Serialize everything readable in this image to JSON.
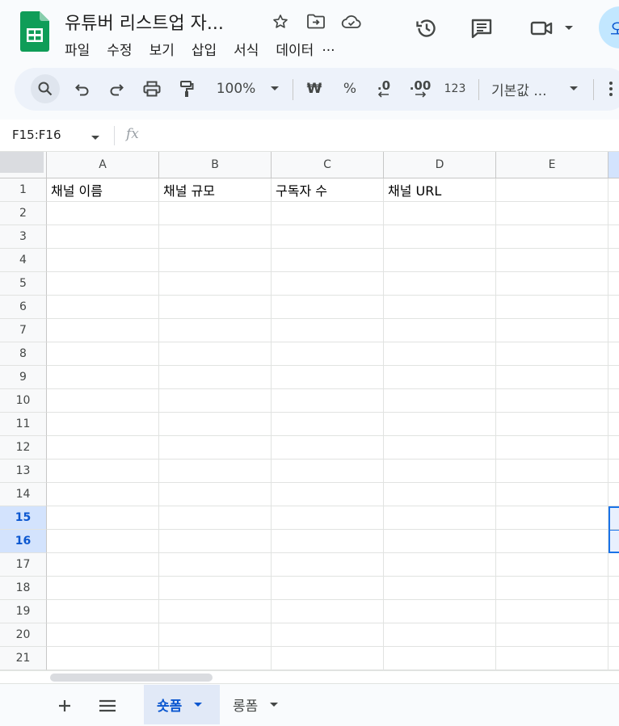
{
  "app": {
    "title": "유튜버 리스트업 자...",
    "menus": [
      "파일",
      "수정",
      "보기",
      "삽입",
      "서식",
      "데이터",
      "..."
    ],
    "avatar_initial": "오",
    "icons": [
      "star-icon",
      "move-to-folder-icon",
      "cloud-saved-icon",
      "history-icon",
      "comment-icon",
      "meet-video-icon",
      "chevron-down-icon"
    ]
  },
  "toolbar": {
    "zoom": "100%",
    "currency": "₩",
    "percent": "%",
    "decrease_decimal": ".0",
    "increase_decimal": ".00",
    "number_format": "123",
    "font_default": "기본값 ..."
  },
  "formula_bar": {
    "name_box": "F15:F16",
    "fx": "fx"
  },
  "grid": {
    "columns": [
      "A",
      "B",
      "C",
      "D",
      "E"
    ],
    "rows": [
      "1",
      "2",
      "3",
      "4",
      "5",
      "6",
      "7",
      "8",
      "9",
      "10",
      "11",
      "12",
      "13",
      "14",
      "15",
      "16",
      "17",
      "18",
      "19",
      "20",
      "21"
    ],
    "selected_rows": [
      "15",
      "16"
    ],
    "row1_values": [
      "채널 이름",
      "채널 규모",
      "구독자 수",
      "채널 URL",
      ""
    ]
  },
  "sheets": {
    "tabs": [
      {
        "label": "숏폼",
        "active": true
      },
      {
        "label": "롱폼",
        "active": false
      }
    ]
  },
  "colors": {
    "accent": "#0b57d0",
    "sheets_green": "#0f9d58",
    "selection": "#d3e3fd",
    "toolbar_bg": "#edf2fa"
  }
}
